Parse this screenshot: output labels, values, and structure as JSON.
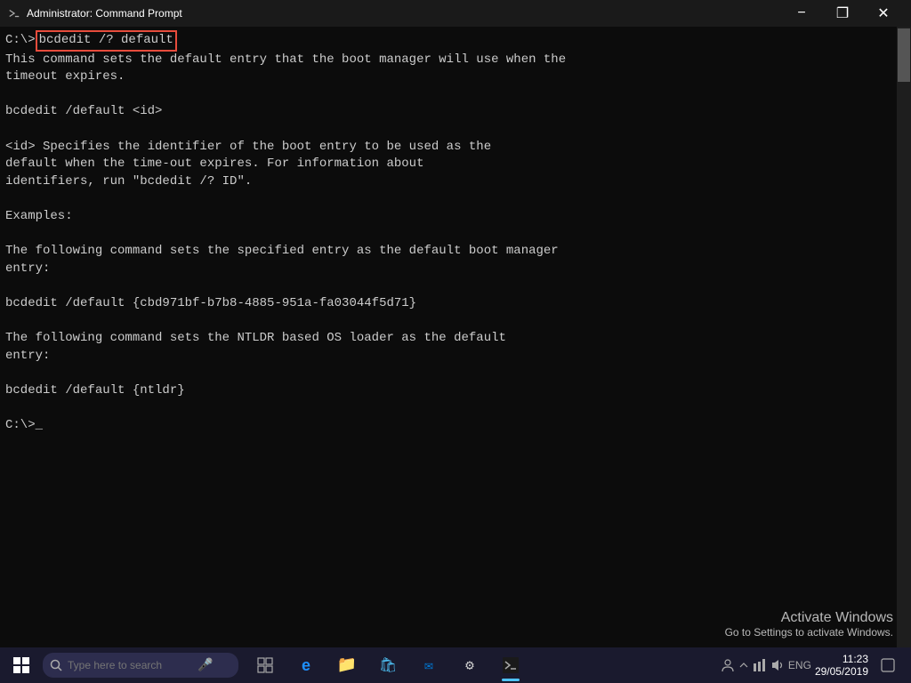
{
  "titlebar": {
    "icon": "cmd-icon",
    "title": "Administrator: Command Prompt",
    "minimize_label": "−",
    "restore_label": "❐",
    "close_label": "✕"
  },
  "terminal": {
    "prompt1": "C:\\>",
    "command": "bcdedit /? default",
    "line1": "This command sets the default entry that the boot manager will use when the",
    "line2": "timeout expires.",
    "line3": "",
    "line4": "bcdedit /default <id>",
    "line5": "",
    "line6": "    <id>     Specifies the identifier of the boot entry to be used as the",
    "line7": "             default when the time-out expires. For information about",
    "line8": "             identifiers, run \"bcdedit /? ID\".",
    "line9": "",
    "line10": "Examples:",
    "line11": "",
    "line12": "The following command sets the specified entry as the default boot manager",
    "line13": "entry:",
    "line14": "",
    "line15": "    bcdedit /default {cbd971bf-b7b8-4885-951a-fa03044f5d71}",
    "line16": "",
    "line17": "The following command sets the NTLDR based OS loader as the default",
    "line18": "entry:",
    "line19": "",
    "line20": "    bcdedit /default {ntldr}",
    "line21": "",
    "prompt2": "C:\\>",
    "cursor": "_"
  },
  "watermark": {
    "line1": "Activate Windows",
    "line2": "Go to Settings to activate Windows."
  },
  "taskbar": {
    "search_placeholder": "Type here to search",
    "eng_label": "ENG",
    "time": "11:23",
    "date": "29/05/2019"
  }
}
